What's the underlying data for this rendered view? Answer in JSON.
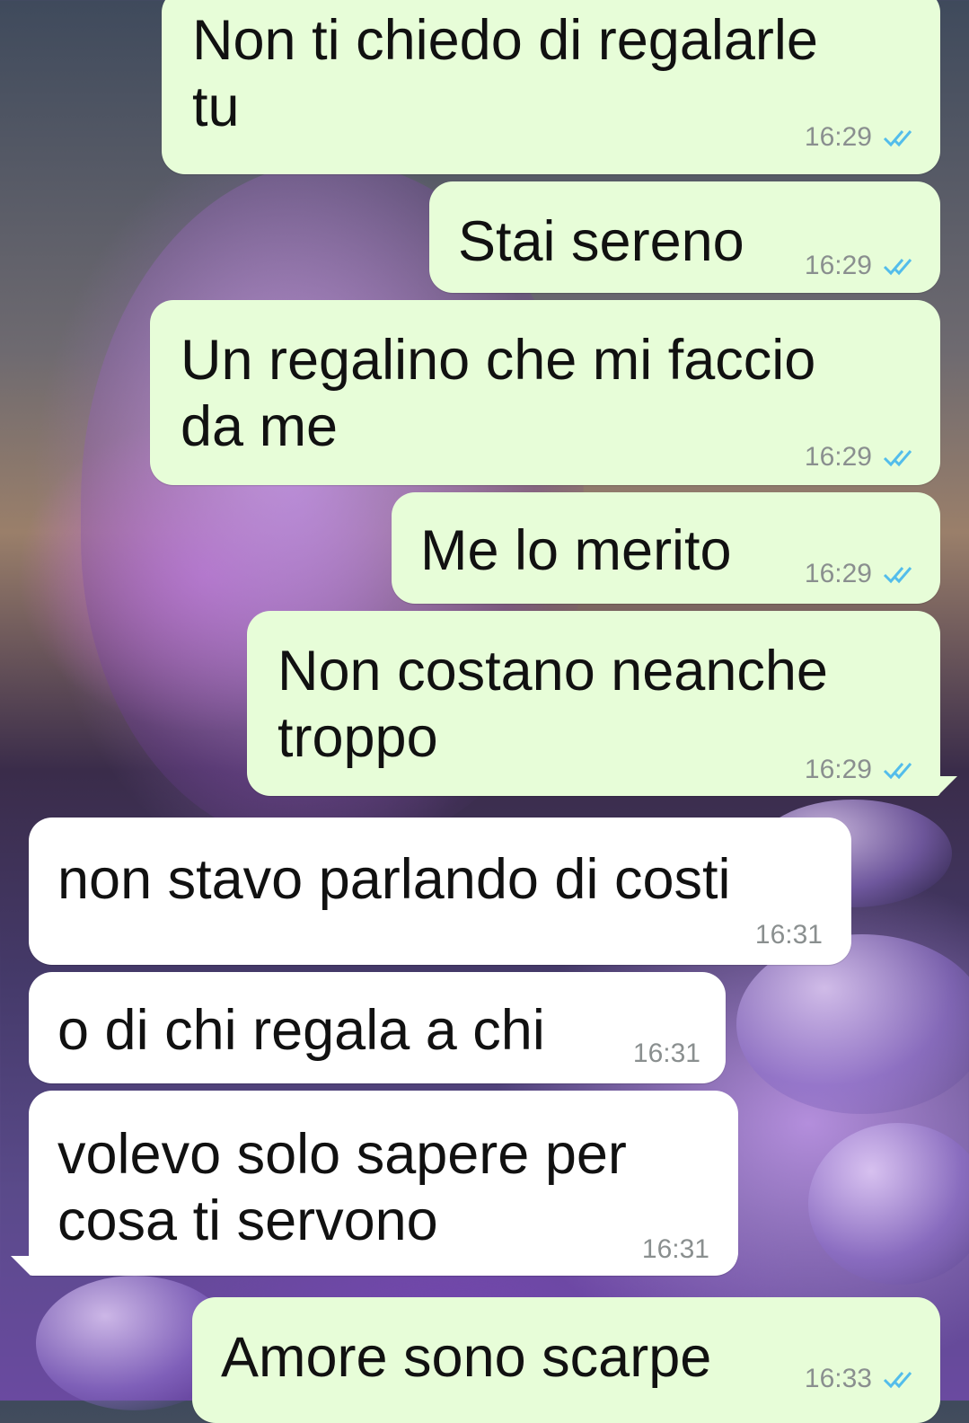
{
  "colors": {
    "outgoing_bubble": "#e7fdd8",
    "incoming_bubble": "#ffffff",
    "timestamp": "#8a8f8f",
    "read_ticks": "#53bdeb"
  },
  "messages": [
    {
      "direction": "out",
      "text": "Non ti chiedo di regalarle\ntu",
      "time": "16:29",
      "status": "double-check-icon"
    },
    {
      "direction": "out",
      "text": "Stai sereno",
      "time": "16:29",
      "status": "double-check-icon"
    },
    {
      "direction": "out",
      "text": "Un regalino che mi faccio\nda me",
      "time": "16:29",
      "status": "double-check-icon"
    },
    {
      "direction": "out",
      "text": "Me lo merito",
      "time": "16:29",
      "status": "double-check-icon"
    },
    {
      "direction": "out",
      "text": "Non costano neanche\ntroppo",
      "time": "16:29",
      "status": "double-check-icon"
    },
    {
      "direction": "in",
      "text": "non stavo parlando di costi",
      "time": "16:31"
    },
    {
      "direction": "in",
      "text": "o di chi regala a chi",
      "time": "16:31"
    },
    {
      "direction": "in",
      "text": "volevo solo sapere per\ncosa ti servono",
      "time": "16:31"
    },
    {
      "direction": "out",
      "text": "Amore sono scarpe",
      "time": "16:33",
      "status": "double-check-icon"
    }
  ]
}
